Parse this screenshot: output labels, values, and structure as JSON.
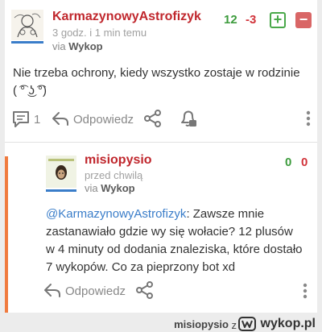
{
  "main_comment": {
    "username": "KarmazynowyAstrofizyk",
    "time": "3 godz. i 1 min temu",
    "via_prefix": "via",
    "via_source": "Wykop",
    "plus_count": "12",
    "minus_count": "-3",
    "vote_up_label": "+",
    "vote_down_label": "−",
    "text": "Nie trzeba ochrony, kiedy wszystko zostaje w rodzinie ( ͡° ͜ʖ ͡°)",
    "reply_count": "1",
    "reply_label": "Odpowiedz"
  },
  "reply_comment": {
    "username": "misiopysio",
    "time": "przed chwilą",
    "via_prefix": "via",
    "via_source": "Wykop",
    "plus_count": "0",
    "minus_count": "0",
    "mention": "@KarmazynowyAstrofizyk",
    "text": ": Zawsze mnie zastanawiało gdzie wy się wołacie? 12 plusów w 4 minuty od dodania znaleziska, które dostało 7 wykopów. Co za pieprzony bot xd",
    "reply_label": "Odpowiedz"
  },
  "footer": {
    "username": "misiopysio",
    "separator": "z",
    "brand": "wykop.pl"
  },
  "colors": {
    "username": "#c0272d",
    "plus": "#3c9b3c",
    "minus": "#d1333a",
    "reply_border": "#f07b3f",
    "mention": "#3a7dc9"
  },
  "icons": [
    "comment-icon",
    "reply-arrow-icon",
    "share-icon",
    "bell-icon",
    "more-vertical-icon",
    "wykop-logo-icon"
  ]
}
